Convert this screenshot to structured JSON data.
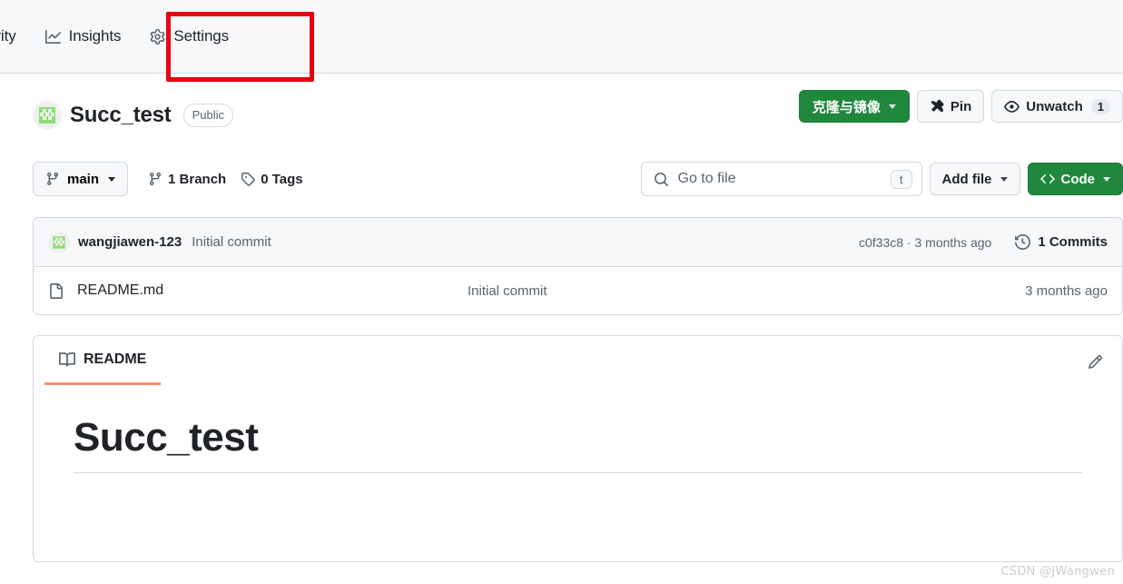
{
  "nav": {
    "tabs": [
      {
        "label": "urity",
        "icon": "shield-icon",
        "truncated": true
      },
      {
        "label": "Insights",
        "icon": "graph-icon",
        "truncated": false
      },
      {
        "label": "Settings",
        "icon": "gear-icon",
        "truncated": false
      }
    ],
    "highlight_color": "#e60012"
  },
  "repo": {
    "name": "Succ_test",
    "visibility": "Public",
    "avatar_color": "#8ede6f",
    "actions": {
      "clone_label": "克隆与镜像",
      "pin_label": "Pin",
      "watch_label": "Unwatch"
    }
  },
  "toolbar": {
    "branch_label": "main",
    "branch_count": "1 Branch",
    "tag_count": "0 Tags",
    "search_placeholder": "Go to file",
    "search_value": "",
    "search_shortcut": "t",
    "add_file_label": "Add file",
    "code_label": "Code"
  },
  "commit_bar": {
    "author": "wangjiawen-123",
    "message": "Initial commit",
    "hash_and_time": "c0f33c8 · 3 months ago",
    "commits_count": "1 Commits"
  },
  "files": [
    {
      "name": "README.md",
      "icon": "file-icon",
      "commit_message": "Initial commit",
      "time": "3 months ago"
    }
  ],
  "readme": {
    "tab_label": "README",
    "heading": "Succ_test"
  },
  "watermark": "CSDN @JWangwen",
  "colors": {
    "green_button": "#1f883d",
    "accent_underline": "#fd8c73",
    "border": "#d1d9e0",
    "muted_text": "#59636e"
  }
}
